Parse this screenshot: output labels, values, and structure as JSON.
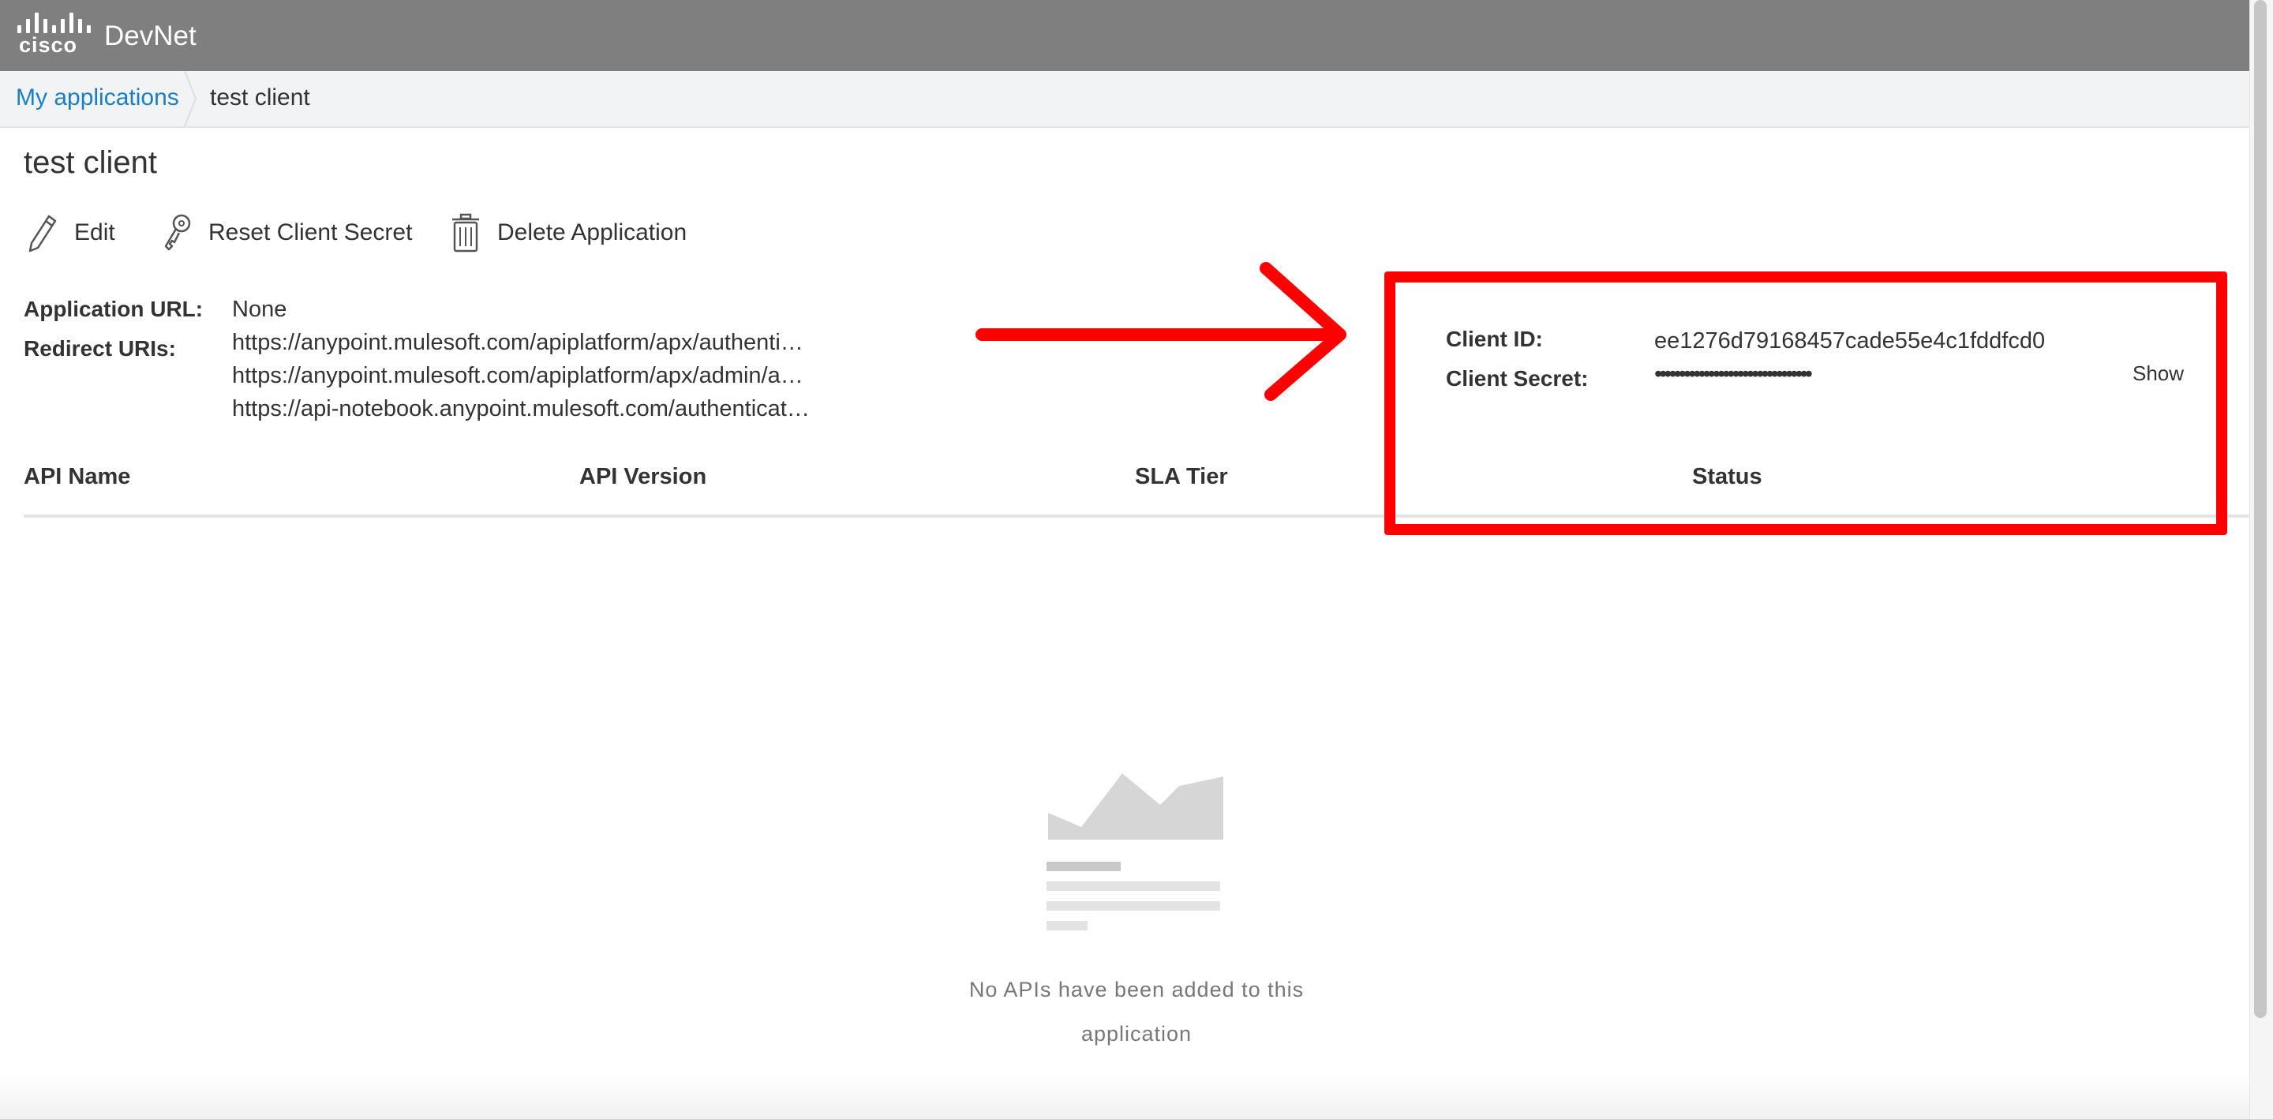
{
  "header": {
    "logo_text": "cisco",
    "brand": "DevNet"
  },
  "breadcrumb": {
    "parent": "My applications",
    "current": "test client"
  },
  "page": {
    "title": "test client"
  },
  "actions": {
    "edit": "Edit",
    "reset_secret": "Reset Client Secret",
    "delete": "Delete Application"
  },
  "info": {
    "app_url_label": "Application URL:",
    "app_url_value": "None",
    "redirect_label": "Redirect URIs:",
    "redirect_uris": [
      "https://anypoint.mulesoft.com/apiplatform/apx/authenti…",
      "https://anypoint.mulesoft.com/apiplatform/apx/admin/a…",
      "https://api-notebook.anypoint.mulesoft.com/authenticat…"
    ]
  },
  "credentials": {
    "client_id_label": "Client ID:",
    "client_id": "ee1276d79168457cade55e4c1fddfcd0",
    "client_secret_label": "Client Secret:",
    "client_secret_masked": "••••••••••••••••••••••••••••••••",
    "show_label": "Show"
  },
  "table": {
    "columns": [
      "API Name",
      "API Version",
      "SLA Tier",
      "Status"
    ]
  },
  "empty_state": {
    "line1": "No APIs have been added to this",
    "line2": "application"
  },
  "colors": {
    "header_bg": "#7f7f7f",
    "link": "#1a7fc4",
    "annotation": "#ff0000"
  }
}
